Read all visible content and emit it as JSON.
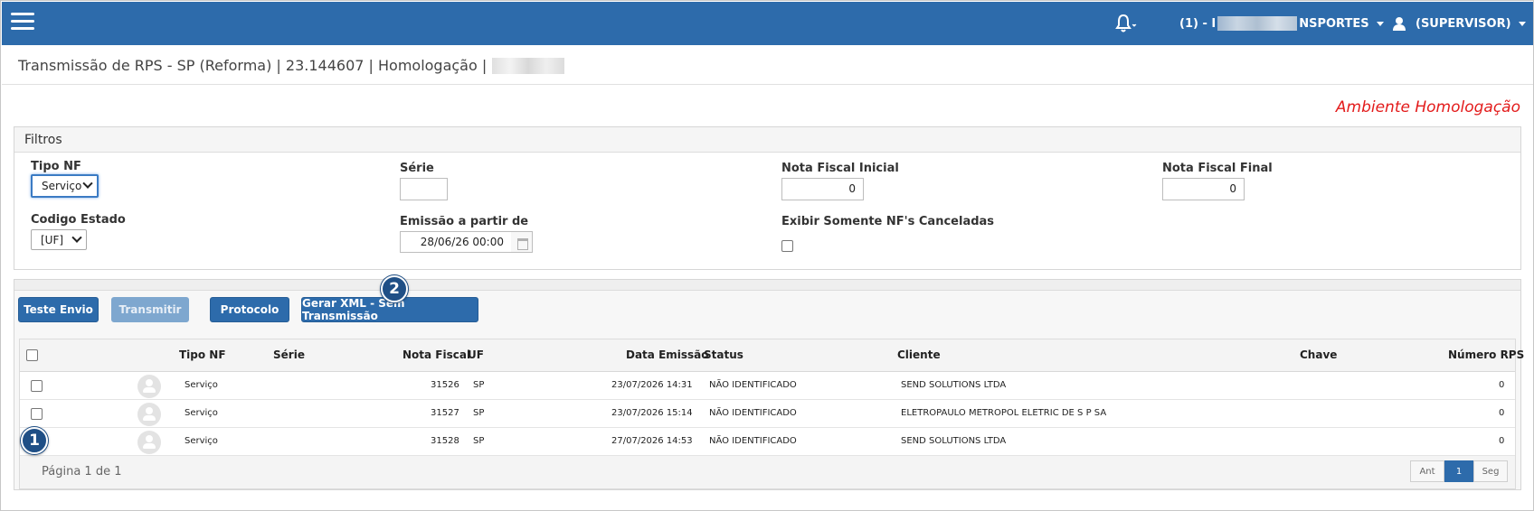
{
  "topbar": {
    "company_prefix": "(1) - I",
    "company_suffix": "NSPORTES",
    "user": "(SUPERVISOR)"
  },
  "page": {
    "title": "Transmissão de RPS - SP (Reforma) | 23.144607 | Homologação |",
    "environment": "Ambiente Homologação"
  },
  "filters": {
    "heading": "Filtros",
    "tipo_nf_label": "Tipo NF",
    "tipo_nf_value": "Serviço",
    "serie_label": "Série",
    "serie_value": "",
    "nf_inicial_label": "Nota Fiscal Inicial",
    "nf_inicial_value": "0",
    "nf_final_label": "Nota Fiscal Final",
    "nf_final_value": "0",
    "codigo_estado_label": "Codigo Estado",
    "codigo_estado_value": "[UF]",
    "emissao_label": "Emissão a partir de",
    "emissao_value": "28/06/26 00:00",
    "canceladas_label": "Exibir Somente NF's Canceladas"
  },
  "actions": {
    "teste_envio": "Teste Envio",
    "transmitir": "Transmitir",
    "protocolo": "Protocolo",
    "gerar_xml": "Gerar XML - Sem Transmissão"
  },
  "markers": {
    "one": "1",
    "two": "2"
  },
  "table": {
    "headers": {
      "tipo_nf": "Tipo NF",
      "serie": "Série",
      "nota_fiscal": "Nota Fiscal",
      "uf": "UF",
      "data_emissao": "Data Emissão",
      "status": "Status",
      "cliente": "Cliente",
      "chave": "Chave",
      "numero_rps": "Número RPS"
    },
    "rows": [
      {
        "tipo": "Serviço",
        "serie": "",
        "nota": "31526",
        "uf": "SP",
        "data": "23/07/2026 14:31",
        "status": "NÃO IDENTIFICADO",
        "cliente": "SEND SOLUTIONS LTDA",
        "chave": "",
        "rps": "0"
      },
      {
        "tipo": "Serviço",
        "serie": "",
        "nota": "31527",
        "uf": "SP",
        "data": "23/07/2026 15:14",
        "status": "NÃO IDENTIFICADO",
        "cliente": "ELETROPAULO METROPOL ELETRIC DE S P SA",
        "chave": "",
        "rps": "0"
      },
      {
        "tipo": "Serviço",
        "serie": "",
        "nota": "31528",
        "uf": "SP",
        "data": "27/07/2026 14:53",
        "status": "NÃO IDENTIFICADO",
        "cliente": "SEND SOLUTIONS LTDA",
        "chave": "",
        "rps": "0"
      }
    ],
    "page_info": "Página 1 de 1",
    "pager": {
      "prev": "Ant",
      "current": "1",
      "next": "Seg"
    }
  },
  "colors": {
    "topbar": "#2d6bab",
    "environment": "#e31b1b",
    "marker": "#1f4f86"
  },
  "icons": [
    "menu-icon",
    "bell-icon",
    "user-icon",
    "calendar-icon",
    "avatar-icon"
  ]
}
